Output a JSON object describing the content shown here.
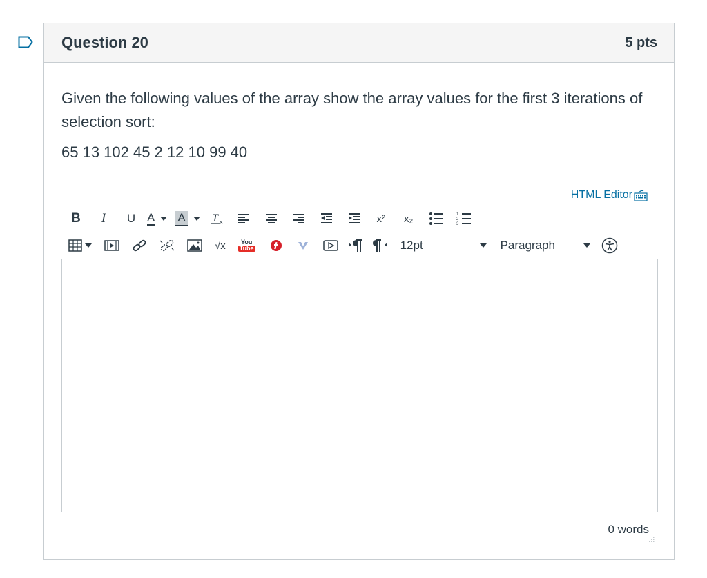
{
  "question": {
    "title": "Question 20",
    "points": "5 pts",
    "text": "Given the following values of the array show the array values for the first 3 iterations of selection sort:",
    "array": "65 13 102 45 2 12 10 99 40"
  },
  "editor": {
    "html_editor_label": "HTML Editor",
    "font_size": "12pt",
    "block_format": "Paragraph",
    "word_count": "0 words",
    "content": ""
  },
  "toolbar": {
    "bold": "B",
    "italic": "I",
    "underline": "U",
    "text_color": "A",
    "bg_color": "A",
    "superscript": "x²",
    "subscript": "x₂",
    "math": "√x",
    "youtube_top": "You",
    "youtube_bottom": "Tube"
  },
  "colors": {
    "link": "#0770a3",
    "border": "#c7cdd1",
    "header_bg": "#f5f5f5",
    "text": "#2d3b45"
  }
}
